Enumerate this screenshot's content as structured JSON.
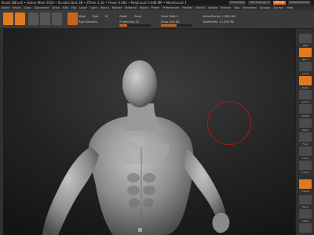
{
  "title": "Brush ZBrush • Active Mem 2024 • Scratch Disk 38 • ZTime 1.10 • Timer 0.064 • PolyCount 0.046 MP • MeshCount 1",
  "titlebar_buttons": [
    {
      "label": "QuickSave",
      "style": "dark"
    },
    {
      "label": "See-through 0",
      "style": "dark"
    },
    {
      "label": "Menus",
      "style": "orange"
    },
    {
      "label": "DefaultZScript",
      "style": "dark"
    }
  ],
  "menu": [
    "Alpha",
    "Brush",
    "Color",
    "Document",
    "Draw",
    "Edit",
    "File",
    "Layer",
    "Light",
    "Macro",
    "Marker",
    "Material",
    "Movie",
    "Picker",
    "Preferences",
    "Render",
    "Stencil",
    "Stroke",
    "Texture",
    "Tool",
    "Transform",
    "Zplugin",
    "Zscript",
    "Help"
  ],
  "toolbar": {
    "mrgb": "Mrgb",
    "rgb": "Rgb",
    "m": "M",
    "zadd": "Zadd",
    "zsub": "Zsub",
    "rgb_intensity": "Rgb Intensity",
    "z_intensity": "Z Intensity 25",
    "focal_shift": "Focal Shift 0",
    "draw_size": "Draw Size 64",
    "active_points": "ActivePoints: 2,380,181",
    "total_points": "TotalPoints: 11.635 Mil"
  },
  "colors": {
    "accent": "#e07a22",
    "brush_circle": "#b01818"
  },
  "right_shelf": [
    "BPR",
    "SPix 3",
    "Scroll",
    "Zoom",
    "Actual",
    "AAHalf",
    "Persp",
    "Floor",
    "Local",
    "L.Sym",
    "Frame",
    "Move",
    "Scale",
    "Rotate",
    "PolyF",
    "Transp"
  ]
}
